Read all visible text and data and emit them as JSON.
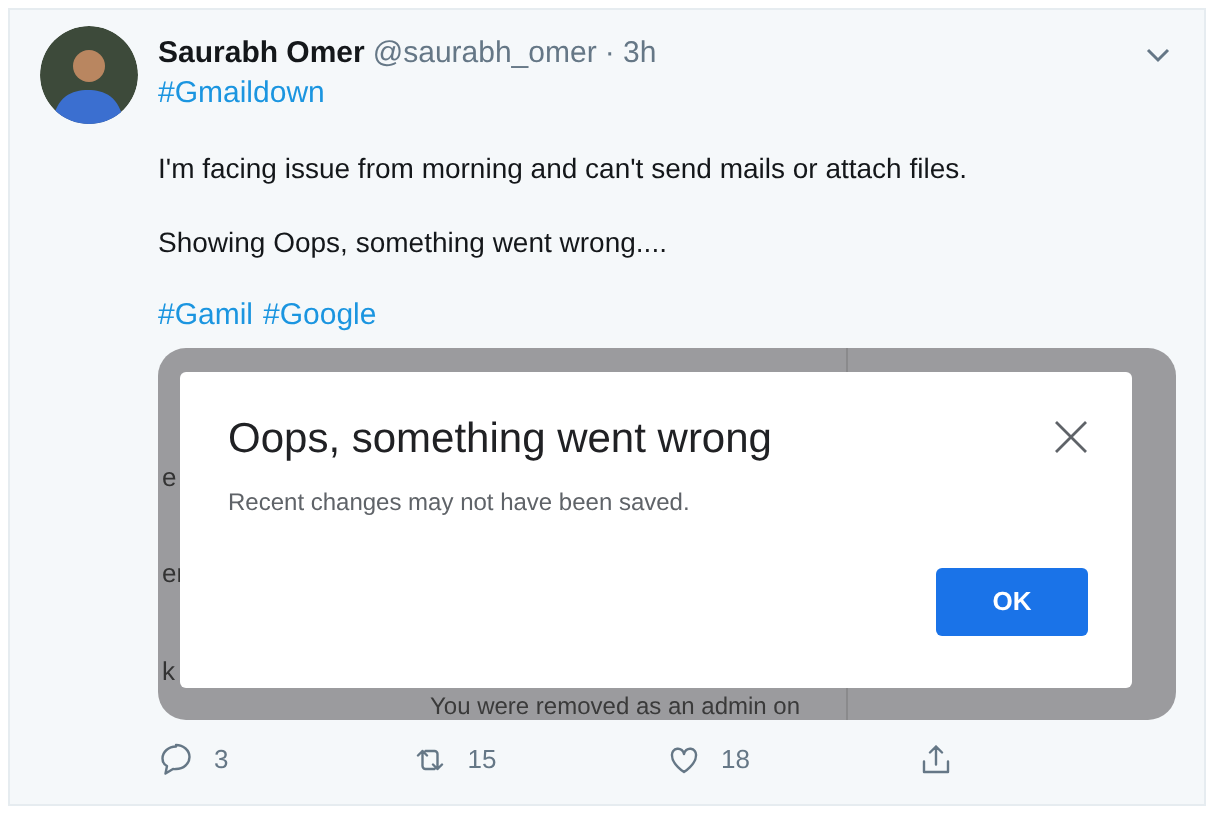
{
  "tweet": {
    "name": "Saurabh Omer",
    "handle": "@saurabh_omer",
    "time": "· 3h",
    "hashtag_line": "#Gmaildown",
    "paragraphs": [
      "I'm facing issue from morning and can't send mails or attach files.",
      "Showing Oops, something went wrong...."
    ],
    "tags": [
      "#Gamil",
      "#Google"
    ],
    "screenshot": {
      "background_fragments": [
        "e",
        "er",
        "k"
      ],
      "background_text": "You were removed as an admin on",
      "dialog": {
        "title": "Oops, something went wrong",
        "message": "Recent changes may not have been saved.",
        "button": "OK"
      }
    },
    "actions": [
      {
        "kind": "reply",
        "count": "3"
      },
      {
        "kind": "retweet",
        "count": "15"
      },
      {
        "kind": "like",
        "count": "18"
      },
      {
        "kind": "share"
      }
    ]
  }
}
